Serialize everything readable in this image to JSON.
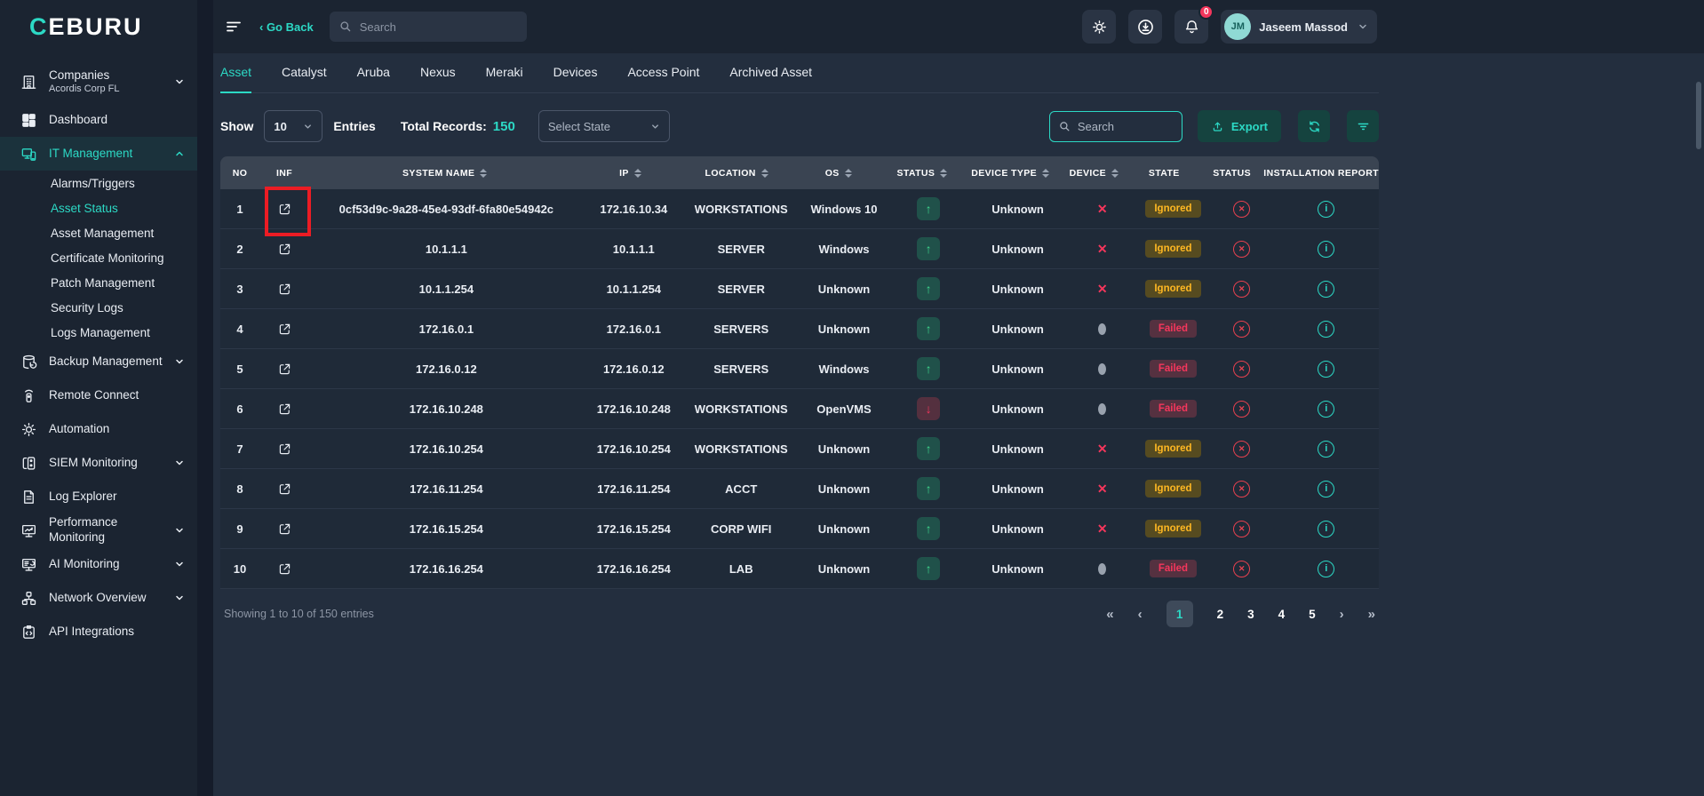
{
  "brand": {
    "logo_accent": "C",
    "logo_rest": "EBURU"
  },
  "topbar": {
    "go_back_label": "‹ Go Back",
    "search_placeholder": "Search",
    "notification_badge": "0",
    "user_initials": "JM",
    "user_name": "Jaseem Massod"
  },
  "sidebar": {
    "items": [
      {
        "label": "Companies",
        "sublabel": "Acordis Corp FL",
        "icon": "building",
        "chevron": "down"
      },
      {
        "label": "Dashboard",
        "icon": "grid"
      },
      {
        "label": "IT Management",
        "icon": "devices",
        "chevron": "up",
        "active": true
      },
      {
        "label": "Alarms/Triggers",
        "sub": true
      },
      {
        "label": "Asset Status",
        "sub": true,
        "active": true
      },
      {
        "label": "Asset Management",
        "sub": true
      },
      {
        "label": "Certificate Monitoring",
        "sub": true
      },
      {
        "label": "Patch Management",
        "sub": true
      },
      {
        "label": "Security Logs",
        "sub": true
      },
      {
        "label": "Logs Management",
        "sub": true
      },
      {
        "label": "Backup Management",
        "icon": "database",
        "chevron": "down"
      },
      {
        "label": "Remote Connect",
        "icon": "remote"
      },
      {
        "label": "Automation",
        "icon": "gear"
      },
      {
        "label": "SIEM Monitoring",
        "icon": "siem",
        "chevron": "down"
      },
      {
        "label": "Log Explorer",
        "icon": "document"
      },
      {
        "label": "Performance Monitoring",
        "icon": "monitor-chart",
        "chevron": "down"
      },
      {
        "label": "AI Monitoring",
        "icon": "monitor-ai",
        "chevron": "down"
      },
      {
        "label": "Network Overview",
        "icon": "network",
        "chevron": "down"
      },
      {
        "label": "API Integrations",
        "icon": "api"
      }
    ]
  },
  "tabs": [
    "Asset",
    "Catalyst",
    "Aruba",
    "Nexus",
    "Meraki",
    "Devices",
    "Access Point",
    "Archived Asset"
  ],
  "active_tab": "Asset",
  "controls": {
    "show_label": "Show",
    "page_size": "10",
    "entries_label": "Entries",
    "total_records_label": "Total Records:",
    "total_records_value": "150",
    "state_filter_placeholder": "Select State",
    "search_placeholder": "Search",
    "export_label": "Export"
  },
  "table": {
    "headers": [
      {
        "label": "NO",
        "sortable": false
      },
      {
        "label": "INF",
        "sortable": false
      },
      {
        "label": "SYSTEM NAME",
        "sortable": true
      },
      {
        "label": "IP",
        "sortable": true
      },
      {
        "label": "LOCATION",
        "sortable": true
      },
      {
        "label": "OS",
        "sortable": true
      },
      {
        "label": "STATUS",
        "sortable": true
      },
      {
        "label": "DEVICE TYPE",
        "sortable": true
      },
      {
        "label": "DEVICE",
        "sortable": true
      },
      {
        "label": "STATE",
        "sortable": false
      },
      {
        "label": "STATUS",
        "sortable": false
      },
      {
        "label": "INSTALLATION REPORT",
        "sortable": false
      }
    ],
    "rows": [
      {
        "no": "1",
        "system_name": "0cf53d9c-9a28-45e4-93df-6fa80e54942c",
        "ip": "172.16.10.34",
        "location": "WORKSTATIONS",
        "os": "Windows 10",
        "status": "up",
        "device_type": "Unknown",
        "device": "x",
        "state": "Ignored",
        "highlighted": true
      },
      {
        "no": "2",
        "system_name": "10.1.1.1",
        "ip": "10.1.1.1",
        "location": "SERVER",
        "os": "Windows",
        "status": "up",
        "device_type": "Unknown",
        "device": "x",
        "state": "Ignored"
      },
      {
        "no": "3",
        "system_name": "10.1.1.254",
        "ip": "10.1.1.254",
        "location": "SERVER",
        "os": "Unknown",
        "status": "up",
        "device_type": "Unknown",
        "device": "x",
        "state": "Ignored"
      },
      {
        "no": "4",
        "system_name": "172.16.0.1",
        "ip": "172.16.0.1",
        "location": "SERVERS",
        "os": "Unknown",
        "status": "up",
        "device_type": "Unknown",
        "device": "dot",
        "state": "Failed"
      },
      {
        "no": "5",
        "system_name": "172.16.0.12",
        "ip": "172.16.0.12",
        "location": "SERVERS",
        "os": "Windows",
        "status": "up",
        "device_type": "Unknown",
        "device": "dot",
        "state": "Failed"
      },
      {
        "no": "6",
        "system_name": "172.16.10.248",
        "ip": "172.16.10.248",
        "location": "WORKSTATIONS",
        "os": "OpenVMS",
        "status": "down",
        "device_type": "Unknown",
        "device": "dot",
        "state": "Failed"
      },
      {
        "no": "7",
        "system_name": "172.16.10.254",
        "ip": "172.16.10.254",
        "location": "WORKSTATIONS",
        "os": "Unknown",
        "status": "up",
        "device_type": "Unknown",
        "device": "x",
        "state": "Ignored"
      },
      {
        "no": "8",
        "system_name": "172.16.11.254",
        "ip": "172.16.11.254",
        "location": "ACCT",
        "os": "Unknown",
        "status": "up",
        "device_type": "Unknown",
        "device": "x",
        "state": "Ignored"
      },
      {
        "no": "9",
        "system_name": "172.16.15.254",
        "ip": "172.16.15.254",
        "location": "CORP WIFI",
        "os": "Unknown",
        "status": "up",
        "device_type": "Unknown",
        "device": "x",
        "state": "Ignored"
      },
      {
        "no": "10",
        "system_name": "172.16.16.254",
        "ip": "172.16.16.254",
        "location": "LAB",
        "os": "Unknown",
        "status": "up",
        "device_type": "Unknown",
        "device": "dot",
        "state": "Failed"
      }
    ]
  },
  "footer": {
    "summary": "Showing 1 to 10 of 150 entries",
    "pages": [
      "1",
      "2",
      "3",
      "4",
      "5"
    ],
    "active_page": "1"
  },
  "colors": {
    "accent_teal": "#2CD9C5",
    "status_green": "#3DD68C",
    "status_red": "#F5365C",
    "ignored_yellow": "#FFB822",
    "annotation_red": "#EC1C24",
    "sidebar_bg": "#1B2431",
    "content_bg": "#232E3E",
    "table_header_bg": "#3A4452"
  }
}
